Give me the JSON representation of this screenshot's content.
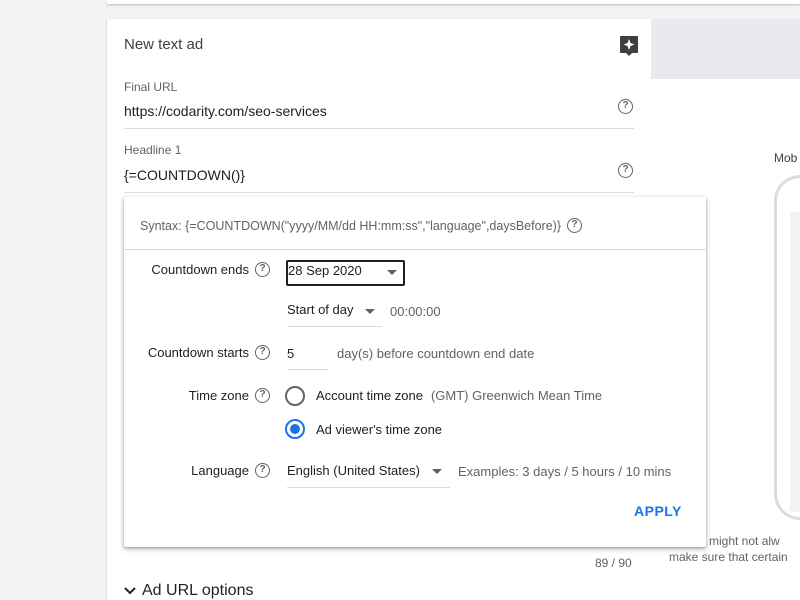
{
  "card": {
    "title": "New text ad",
    "final_url": {
      "label": "Final URL",
      "value": "https://codarity.com/seo-services"
    },
    "headline1": {
      "label": "Headline 1",
      "value": "{=COUNTDOWN()}"
    },
    "char_counter": "89 / 90",
    "url_options": "Ad URL options"
  },
  "preview": {
    "label": "Mob",
    "note_line1": "d might not alw",
    "note_line2": "make sure that certain"
  },
  "countdown_popup": {
    "syntax": "Syntax: {=COUNTDOWN(\"yyyy/MM/dd HH:mm:ss\",\"language\",daysBefore)}",
    "countdown_ends": {
      "label": "Countdown ends",
      "date": "28 Sep 2020",
      "time_of_day": "Start of day",
      "time": "00:00:00"
    },
    "countdown_starts": {
      "label": "Countdown starts",
      "days": "5",
      "suffix": "day(s) before countdown end date"
    },
    "time_zone": {
      "label": "Time zone",
      "options": [
        {
          "label": "Account time zone",
          "detail": "(GMT) Greenwich Mean Time",
          "checked": false
        },
        {
          "label": "Ad viewer's time zone",
          "detail": "",
          "checked": true
        }
      ]
    },
    "language": {
      "label": "Language",
      "value": "English (United States)",
      "examples": "Examples: 3 days / 5 hours / 10 mins"
    },
    "apply_label": "APPLY"
  },
  "colors": {
    "accent": "#1a73e8",
    "text": "#202124",
    "muted": "#5f6368",
    "divider": "#dadce0"
  },
  "icons": [
    "help-icon",
    "magic-icon",
    "chevron-down-icon",
    "caret-down-icon"
  ]
}
